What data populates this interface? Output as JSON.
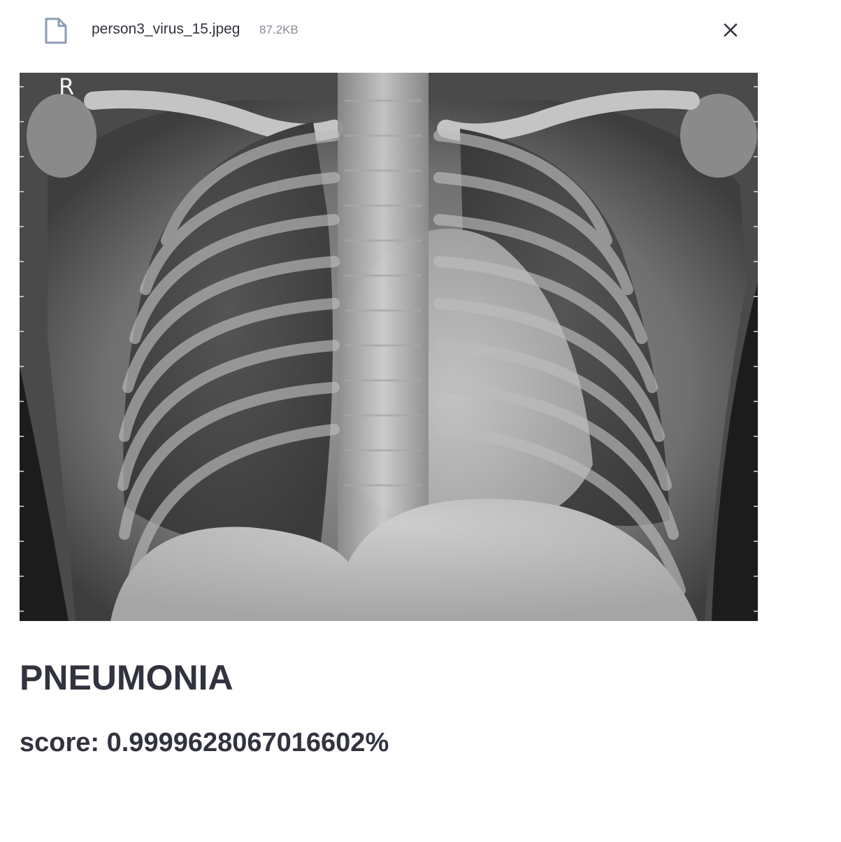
{
  "file": {
    "name": "person3_virus_15.jpeg",
    "size": "87.2KB",
    "icon": "file-icon",
    "close_icon": "close-icon"
  },
  "image": {
    "marker": "R"
  },
  "result": {
    "label": "PNEUMONIA",
    "score": "score: 0.9999628067016602%"
  },
  "colors": {
    "text": "#31333f",
    "muted": "#8a8c97",
    "icon": "#8e9cb3"
  }
}
